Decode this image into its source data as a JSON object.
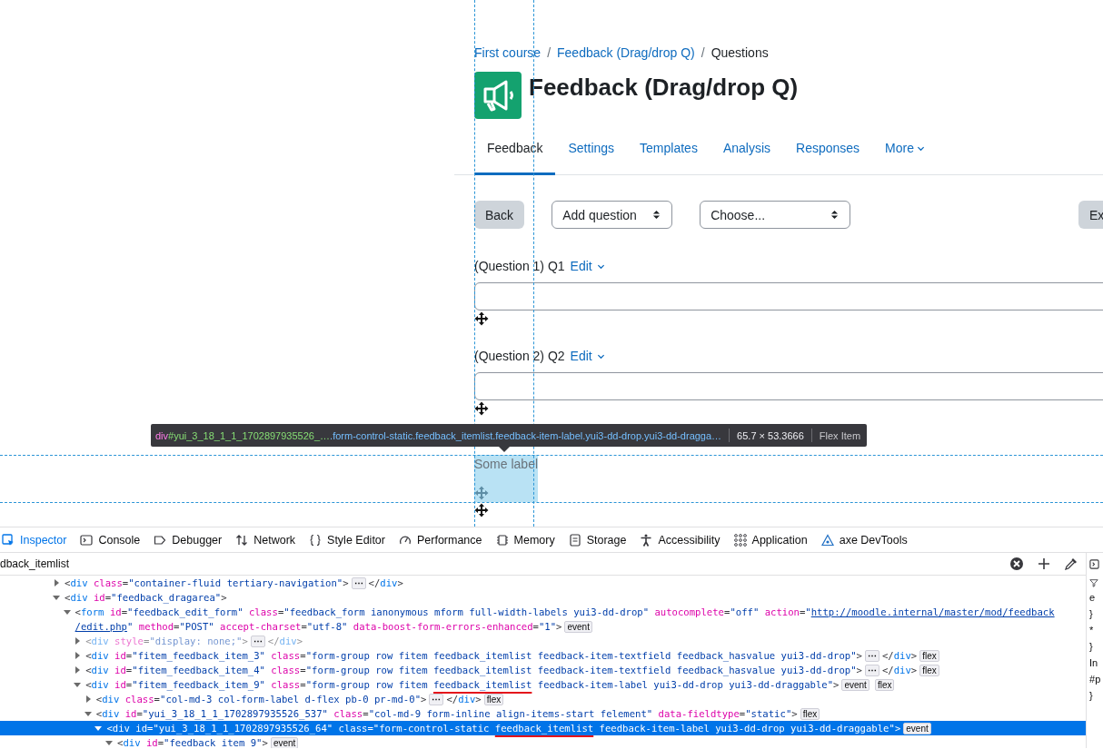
{
  "page": {
    "breadcrumb": [
      {
        "text": "First course",
        "link": true
      },
      {
        "text": "Feedback (Drag/drop Q)",
        "link": true
      },
      {
        "text": "Questions",
        "link": false
      }
    ],
    "separator": "/",
    "title": "Feedback (Drag/drop Q)",
    "tabs": [
      {
        "label": "Feedback",
        "selected": true,
        "menu": false
      },
      {
        "label": "Settings",
        "selected": false,
        "menu": false
      },
      {
        "label": "Templates",
        "selected": false,
        "menu": false
      },
      {
        "label": "Analysis",
        "selected": false,
        "menu": false
      },
      {
        "label": "Responses",
        "selected": false,
        "menu": false
      },
      {
        "label": "More",
        "selected": false,
        "menu": true
      }
    ],
    "actions": [
      {
        "kind": "button",
        "label": "Back"
      },
      {
        "kind": "select",
        "label": "Add question"
      },
      {
        "kind": "select",
        "label": "Choose..."
      }
    ],
    "actions_right": [
      {
        "kind": "button",
        "label": "Ex"
      }
    ],
    "items": [
      {
        "kind": "textfield",
        "label": "(Question 1) Q1",
        "edit": "Edit",
        "highlighted": false
      },
      {
        "kind": "textfield",
        "label": "(Question 2) Q2",
        "edit": "Edit",
        "highlighted": false
      },
      {
        "kind": "label",
        "text": "Some label",
        "highlighted": true
      }
    ]
  },
  "tooltip": {
    "tag": "div",
    "id": "#yui_3_18_1_1_1702897935526_…",
    "classes": ".form-control-static.feedback_itemlist.feedback-item-label.yui3-dd-drop.yui3-dd-dragga…",
    "size": "65.7 × 53.3666",
    "type": "Flex Item"
  },
  "inspector": {
    "tabs": [
      {
        "label": "Inspector",
        "selected": true
      },
      {
        "label": "Console",
        "selected": false
      },
      {
        "label": "Debugger",
        "selected": false
      },
      {
        "label": "Network",
        "selected": false
      },
      {
        "label": "Style Editor",
        "selected": false
      },
      {
        "label": "Performance",
        "selected": false
      },
      {
        "label": "Memory",
        "selected": false
      },
      {
        "label": "Storage",
        "selected": false
      },
      {
        "label": "Accessibility",
        "selected": false
      },
      {
        "label": "Application",
        "selected": false
      },
      {
        "label": "axe DevTools",
        "selected": false
      }
    ],
    "search": {
      "value": "dback_itemlist"
    },
    "rules_fragments": [
      "e",
      "}",
      "*",
      "}",
      "In",
      "#p",
      "}"
    ],
    "tree": [
      {
        "expanded": false,
        "selected": false,
        "dimmed": false,
        "lines": [
          [
            {
              "kind": "punct",
              "text": "<"
            },
            {
              "kind": "tag",
              "text": "div"
            },
            {
              "kind": "attr",
              "text": " class"
            },
            {
              "kind": "punct",
              "text": "="
            },
            {
              "kind": "value",
              "text": "\"container-fluid tertiary-navigation\""
            },
            {
              "kind": "punct",
              "text": ">"
            },
            {
              "kind": "more",
              "text": "⋯"
            },
            {
              "kind": "punct",
              "text": "</"
            },
            {
              "kind": "tag",
              "text": "div"
            },
            {
              "kind": "punct",
              "text": ">"
            }
          ]
        ]
      },
      {
        "expanded": true,
        "selected": false,
        "dimmed": false,
        "lines": [
          [
            {
              "kind": "punct",
              "text": "<"
            },
            {
              "kind": "tag",
              "text": "div"
            },
            {
              "kind": "attr",
              "text": " id"
            },
            {
              "kind": "punct",
              "text": "="
            },
            {
              "kind": "value",
              "text": "\"feedback_dragarea\""
            },
            {
              "kind": "punct",
              "text": ">"
            }
          ]
        ],
        "children": [
          {
            "expanded": true,
            "selected": false,
            "dimmed": false,
            "lines": [
              [
                {
                  "kind": "punct",
                  "text": "<"
                },
                {
                  "kind": "tag",
                  "text": "form"
                },
                {
                  "kind": "attr",
                  "text": " id"
                },
                {
                  "kind": "punct",
                  "text": "="
                },
                {
                  "kind": "value",
                  "text": "\"feedback_edit_form\""
                },
                {
                  "kind": "attr",
                  "text": " class"
                },
                {
                  "kind": "punct",
                  "text": "="
                },
                {
                  "kind": "value",
                  "text": "\"feedback_form ianonymous mform full-width-labels yui3-dd-drop\""
                },
                {
                  "kind": "attr",
                  "text": " autocomplete"
                },
                {
                  "kind": "punct",
                  "text": "="
                },
                {
                  "kind": "value",
                  "text": "\"off\""
                },
                {
                  "kind": "attr",
                  "text": " action"
                },
                {
                  "kind": "punct",
                  "text": "="
                },
                {
                  "kind": "value",
                  "text": "\""
                },
                {
                  "kind": "link",
                  "text": "http://moodle.internal/master/mod/feedback"
                }
              ],
              [
                {
                  "kind": "link",
                  "text": "/edit.php"
                },
                {
                  "kind": "value",
                  "text": "\""
                },
                {
                  "kind": "attr",
                  "text": " method"
                },
                {
                  "kind": "punct",
                  "text": "="
                },
                {
                  "kind": "value",
                  "text": "\"POST\""
                },
                {
                  "kind": "attr",
                  "text": " accept-charset"
                },
                {
                  "kind": "punct",
                  "text": "="
                },
                {
                  "kind": "value",
                  "text": "\"utf-8\""
                },
                {
                  "kind": "attr",
                  "text": " data-boost-form-errors-enhanced"
                },
                {
                  "kind": "punct",
                  "text": "="
                },
                {
                  "kind": "value",
                  "text": "\"1\""
                },
                {
                  "kind": "punct",
                  "text": ">"
                },
                {
                  "kind": "badge",
                  "text": "event"
                }
              ]
            ],
            "children": [
              {
                "expanded": false,
                "selected": false,
                "dimmed": true,
                "lines": [
                  [
                    {
                      "kind": "punct",
                      "text": "<"
                    },
                    {
                      "kind": "tag",
                      "text": "div"
                    },
                    {
                      "kind": "attr",
                      "text": " style"
                    },
                    {
                      "kind": "punct",
                      "text": "="
                    },
                    {
                      "kind": "value",
                      "text": "\"display: none;\""
                    },
                    {
                      "kind": "punct",
                      "text": ">"
                    },
                    {
                      "kind": "more",
                      "text": "⋯"
                    },
                    {
                      "kind": "punct",
                      "text": "</"
                    },
                    {
                      "kind": "tag",
                      "text": "div"
                    },
                    {
                      "kind": "punct",
                      "text": ">"
                    }
                  ]
                ]
              },
              {
                "expanded": false,
                "selected": false,
                "dimmed": false,
                "lines": [
                  [
                    {
                      "kind": "punct",
                      "text": "<"
                    },
                    {
                      "kind": "tag",
                      "text": "div"
                    },
                    {
                      "kind": "attr",
                      "text": " id"
                    },
                    {
                      "kind": "punct",
                      "text": "="
                    },
                    {
                      "kind": "value",
                      "text": "\"fitem_feedback_item_3\""
                    },
                    {
                      "kind": "attr",
                      "text": " class"
                    },
                    {
                      "kind": "punct",
                      "text": "="
                    },
                    {
                      "kind": "value",
                      "text": "\"form-group row fitem feedback_itemlist feedback-item-textfield feedback_hasvalue yui3-dd-drop\""
                    },
                    {
                      "kind": "punct",
                      "text": ">"
                    },
                    {
                      "kind": "more",
                      "text": "⋯"
                    },
                    {
                      "kind": "punct",
                      "text": "</"
                    },
                    {
                      "kind": "tag",
                      "text": "div"
                    },
                    {
                      "kind": "punct",
                      "text": ">"
                    },
                    {
                      "kind": "badge",
                      "text": "flex"
                    }
                  ]
                ]
              },
              {
                "expanded": false,
                "selected": false,
                "dimmed": false,
                "lines": [
                  [
                    {
                      "kind": "punct",
                      "text": "<"
                    },
                    {
                      "kind": "tag",
                      "text": "div"
                    },
                    {
                      "kind": "attr",
                      "text": " id"
                    },
                    {
                      "kind": "punct",
                      "text": "="
                    },
                    {
                      "kind": "value",
                      "text": "\"fitem_feedback_item_4\""
                    },
                    {
                      "kind": "attr",
                      "text": " class"
                    },
                    {
                      "kind": "punct",
                      "text": "="
                    },
                    {
                      "kind": "value",
                      "text": "\"form-group row fitem feedback_itemlist feedback-item-textfield feedback_hasvalue yui3-dd-drop\""
                    },
                    {
                      "kind": "punct",
                      "text": ">"
                    },
                    {
                      "kind": "more",
                      "text": "⋯"
                    },
                    {
                      "kind": "punct",
                      "text": "</"
                    },
                    {
                      "kind": "tag",
                      "text": "div"
                    },
                    {
                      "kind": "punct",
                      "text": ">"
                    },
                    {
                      "kind": "badge",
                      "text": "flex"
                    }
                  ]
                ]
              },
              {
                "expanded": true,
                "selected": false,
                "dimmed": false,
                "lines": [
                  [
                    {
                      "kind": "punct",
                      "text": "<"
                    },
                    {
                      "kind": "tag",
                      "text": "div"
                    },
                    {
                      "kind": "attr",
                      "text": " id"
                    },
                    {
                      "kind": "punct",
                      "text": "="
                    },
                    {
                      "kind": "value",
                      "text": "\"fitem_feedback_item_9\""
                    },
                    {
                      "kind": "attr",
                      "text": " class"
                    },
                    {
                      "kind": "punct",
                      "text": "="
                    },
                    {
                      "kind": "value",
                      "text": "\"form-group row fitem "
                    },
                    {
                      "kind": "marked",
                      "text": "feedback_itemlist"
                    },
                    {
                      "kind": "value",
                      "text": " feedback-item-label yui3-dd-drop yui3-dd-draggable\""
                    },
                    {
                      "kind": "punct",
                      "text": ">"
                    },
                    {
                      "kind": "badge",
                      "text": "event"
                    },
                    {
                      "kind": "badge",
                      "text": "flex"
                    }
                  ]
                ],
                "children": [
                  {
                    "expanded": false,
                    "selected": false,
                    "dimmed": false,
                    "lines": [
                      [
                        {
                          "kind": "punct",
                          "text": "<"
                        },
                        {
                          "kind": "tag",
                          "text": "div"
                        },
                        {
                          "kind": "attr",
                          "text": " class"
                        },
                        {
                          "kind": "punct",
                          "text": "="
                        },
                        {
                          "kind": "value",
                          "text": "\"col-md-3 col-form-label d-flex pb-0 pr-md-0\""
                        },
                        {
                          "kind": "punct",
                          "text": ">"
                        },
                        {
                          "kind": "more",
                          "text": "⋯"
                        },
                        {
                          "kind": "punct",
                          "text": "</"
                        },
                        {
                          "kind": "tag",
                          "text": "div"
                        },
                        {
                          "kind": "punct",
                          "text": ">"
                        },
                        {
                          "kind": "badge",
                          "text": "flex"
                        }
                      ]
                    ]
                  },
                  {
                    "expanded": true,
                    "selected": false,
                    "dimmed": false,
                    "lines": [
                      [
                        {
                          "kind": "punct",
                          "text": "<"
                        },
                        {
                          "kind": "tag",
                          "text": "div"
                        },
                        {
                          "kind": "attr",
                          "text": " id"
                        },
                        {
                          "kind": "punct",
                          "text": "="
                        },
                        {
                          "kind": "value",
                          "text": "\"yui_3_18_1_1_1702897935526_537\""
                        },
                        {
                          "kind": "attr",
                          "text": " class"
                        },
                        {
                          "kind": "punct",
                          "text": "="
                        },
                        {
                          "kind": "value",
                          "text": "\"col-md-9 form-inline align-items-start felement\""
                        },
                        {
                          "kind": "attr",
                          "text": " data-fieldtype"
                        },
                        {
                          "kind": "punct",
                          "text": "="
                        },
                        {
                          "kind": "value",
                          "text": "\"static\""
                        },
                        {
                          "kind": "punct",
                          "text": ">"
                        },
                        {
                          "kind": "badge",
                          "text": "flex"
                        }
                      ]
                    ],
                    "children": [
                      {
                        "expanded": true,
                        "selected": true,
                        "dimmed": false,
                        "lines": [
                          [
                            {
                              "kind": "punct",
                              "text": "<"
                            },
                            {
                              "kind": "tag",
                              "text": "div"
                            },
                            {
                              "kind": "attr",
                              "text": " id"
                            },
                            {
                              "kind": "punct",
                              "text": "="
                            },
                            {
                              "kind": "value",
                              "text": "\"yui_3_18_1_1_1702897935526_64\""
                            },
                            {
                              "kind": "attr",
                              "text": " class"
                            },
                            {
                              "kind": "punct",
                              "text": "="
                            },
                            {
                              "kind": "value",
                              "text": "\"form-control-static "
                            },
                            {
                              "kind": "marked",
                              "text": "feedback_itemlist"
                            },
                            {
                              "kind": "value",
                              "text": " feedback-item-label yui3-dd-drop yui3-dd-draggable\""
                            },
                            {
                              "kind": "punct",
                              "text": ">"
                            },
                            {
                              "kind": "badge",
                              "text": "event"
                            }
                          ]
                        ],
                        "children": [
                          {
                            "expanded": true,
                            "selected": false,
                            "dimmed": false,
                            "lines": [
                              [
                                {
                                  "kind": "punct",
                                  "text": "<"
                                },
                                {
                                  "kind": "tag",
                                  "text": "div"
                                },
                                {
                                  "kind": "attr",
                                  "text": " id"
                                },
                                {
                                  "kind": "punct",
                                  "text": "="
                                },
                                {
                                  "kind": "value",
                                  "text": "\"feedback_item_9\""
                                },
                                {
                                  "kind": "punct",
                                  "text": ">"
                                },
                                {
                                  "kind": "badge",
                                  "text": "event"
                                }
                              ]
                            ]
                          }
                        ]
                      }
                    ]
                  }
                ]
              }
            ]
          }
        ]
      }
    ]
  }
}
